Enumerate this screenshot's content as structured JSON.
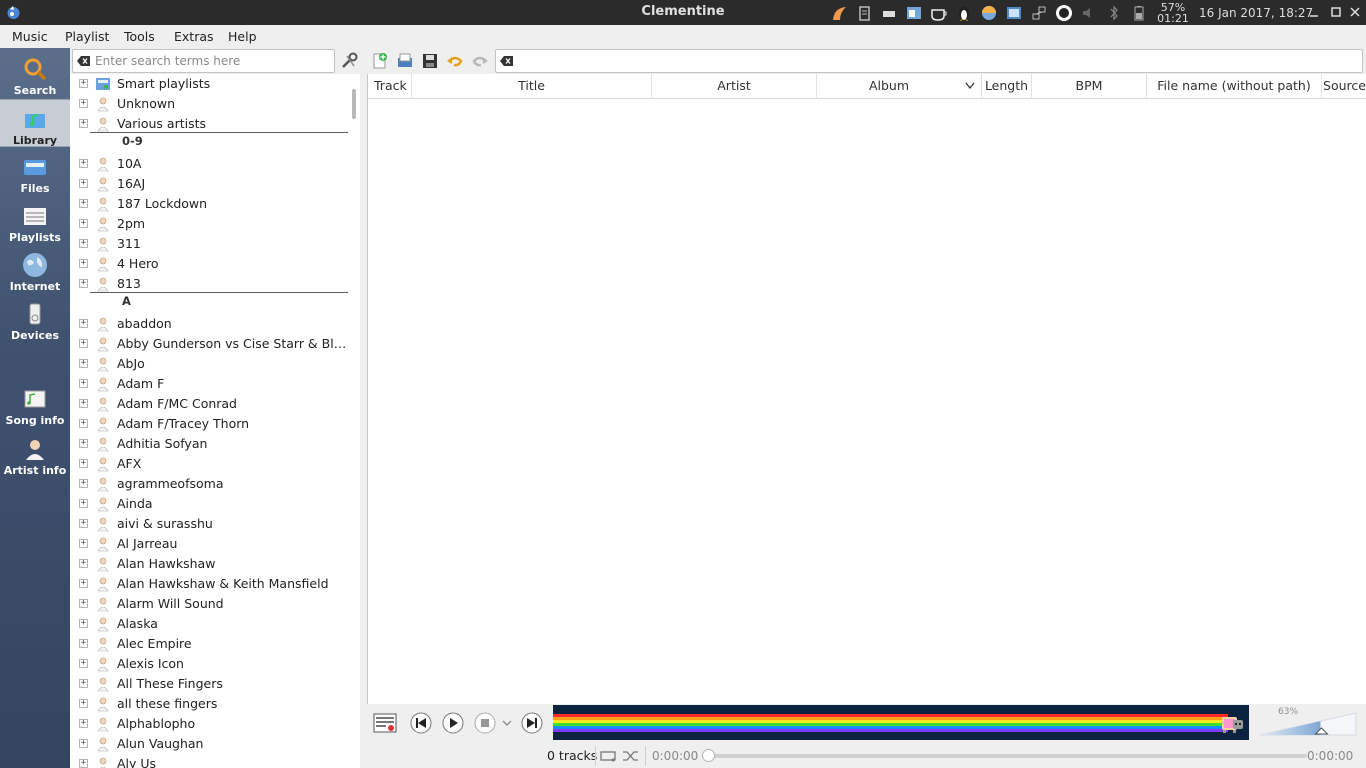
{
  "window": {
    "title": "Clementine"
  },
  "tray": {
    "battery_percent": "57%",
    "battery_time": "01:21",
    "clock": "16 Jan 2017, 18:27"
  },
  "menubar": {
    "items": [
      "Music",
      "Playlist",
      "Tools",
      "Extras",
      "Help"
    ]
  },
  "tabs": [
    {
      "label": "Search",
      "icon": "search-icon"
    },
    {
      "label": "Library",
      "icon": "library-icon",
      "active": true
    },
    {
      "label": "Files",
      "icon": "files-icon"
    },
    {
      "label": "Playlists",
      "icon": "playlists-icon"
    },
    {
      "label": "Internet",
      "icon": "internet-icon"
    },
    {
      "label": "Devices",
      "icon": "devices-icon"
    },
    {
      "label": "Song info",
      "icon": "song-info-icon"
    },
    {
      "label": "Artist info",
      "icon": "artist-info-icon"
    }
  ],
  "library": {
    "search_placeholder": "Enter search terms here",
    "rows": [
      {
        "type": "item",
        "label": "Smart playlists",
        "icon": "smart-playlist-icon"
      },
      {
        "type": "item",
        "label": "Unknown",
        "icon": "artist-icon"
      },
      {
        "type": "item",
        "label": "Various artists",
        "icon": "artist-icon"
      },
      {
        "type": "divider",
        "label": "0-9"
      },
      {
        "type": "item",
        "label": "10A",
        "icon": "artist-icon"
      },
      {
        "type": "item",
        "label": "16AJ",
        "icon": "artist-icon"
      },
      {
        "type": "item",
        "label": "187 Lockdown",
        "icon": "artist-icon"
      },
      {
        "type": "item",
        "label": "2pm",
        "icon": "artist-icon"
      },
      {
        "type": "item",
        "label": "311",
        "icon": "artist-icon"
      },
      {
        "type": "item",
        "label": "4 Hero",
        "icon": "artist-icon"
      },
      {
        "type": "item",
        "label": "813",
        "icon": "artist-icon"
      },
      {
        "type": "divider",
        "label": "A"
      },
      {
        "type": "item",
        "label": "abaddon",
        "icon": "artist-icon"
      },
      {
        "type": "item",
        "label": "Abby Gunderson vs Cise Starr & Blu (P....",
        "icon": "artist-icon"
      },
      {
        "type": "item",
        "label": "AbJo",
        "icon": "artist-icon"
      },
      {
        "type": "item",
        "label": "Adam F",
        "icon": "artist-icon"
      },
      {
        "type": "item",
        "label": "Adam F/MC Conrad",
        "icon": "artist-icon"
      },
      {
        "type": "item",
        "label": "Adam F/Tracey Thorn",
        "icon": "artist-icon"
      },
      {
        "type": "item",
        "label": "Adhitia Sofyan",
        "icon": "artist-icon"
      },
      {
        "type": "item",
        "label": "AFX",
        "icon": "artist-icon"
      },
      {
        "type": "item",
        "label": "agrammeofsoma",
        "icon": "artist-icon"
      },
      {
        "type": "item",
        "label": "Ainda",
        "icon": "artist-icon"
      },
      {
        "type": "item",
        "label": "aivi & surasshu",
        "icon": "artist-icon"
      },
      {
        "type": "item",
        "label": "Al Jarreau",
        "icon": "artist-icon"
      },
      {
        "type": "item",
        "label": "Alan Hawkshaw",
        "icon": "artist-icon"
      },
      {
        "type": "item",
        "label": "Alan Hawkshaw & Keith Mansfield",
        "icon": "artist-icon"
      },
      {
        "type": "item",
        "label": "Alarm Will Sound",
        "icon": "artist-icon"
      },
      {
        "type": "item",
        "label": "Alaska",
        "icon": "artist-icon"
      },
      {
        "type": "item",
        "label": "Alec Empire",
        "icon": "artist-icon"
      },
      {
        "type": "item",
        "label": "Alexis Icon",
        "icon": "artist-icon"
      },
      {
        "type": "item",
        "label": "All These Fingers",
        "icon": "artist-icon"
      },
      {
        "type": "item",
        "label": "all these fingers",
        "icon": "artist-icon"
      },
      {
        "type": "item",
        "label": "Alphablopho",
        "icon": "artist-icon"
      },
      {
        "type": "item",
        "label": "Alun Vaughan",
        "icon": "artist-icon"
      },
      {
        "type": "item",
        "label": "Aly Us",
        "icon": "artist-icon"
      }
    ]
  },
  "playlist": {
    "columns": [
      "Track",
      "Title",
      "Artist",
      "Album",
      "Length",
      "BPM",
      "File name (without path)",
      "Source"
    ],
    "sort_column": "Album"
  },
  "player": {
    "track_count": "0 tracks",
    "time_elapsed": "0:00:00",
    "time_total": "0:00:00",
    "volume_percent": "63%",
    "volume_level": 0.63
  },
  "colors": {
    "titlebar": "#2b2b2b",
    "sidebar": "#3f5270",
    "analyzer_bg": "#0c2340"
  }
}
